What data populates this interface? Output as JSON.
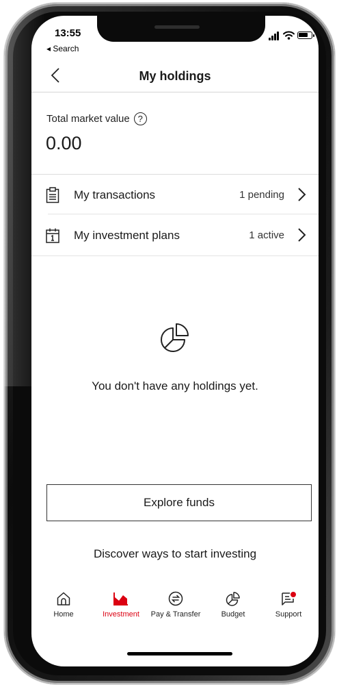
{
  "status_bar": {
    "time": "13:55",
    "back_label": "◂ Search"
  },
  "header": {
    "title": "My holdings",
    "back_icon": "chevron-left-icon"
  },
  "portfolio": {
    "total_label": "Total market value",
    "help_icon": "question-circle-icon",
    "help_glyph": "?",
    "total_value": "0.00"
  },
  "rows": [
    {
      "label": "My transactions",
      "status": "1 pending",
      "icon": "clipboard-list-icon"
    },
    {
      "label": "My investment plans",
      "status": "1 active",
      "icon": "calendar-icon"
    }
  ],
  "empty_state": {
    "icon": "pie-chart-icon",
    "message": "You don't have any holdings yet."
  },
  "actions": {
    "explore_label": "Explore funds",
    "discover_text": "Discover ways to start investing"
  },
  "bottom_nav": {
    "items": [
      {
        "label": "Home",
        "icon": "home-icon",
        "active": false
      },
      {
        "label": "Investment",
        "icon": "investment-chart-icon",
        "active": true
      },
      {
        "label": "Pay & Transfer",
        "icon": "transfer-arrows-icon",
        "active": false
      },
      {
        "label": "Budget",
        "icon": "pie-chart-icon",
        "active": false
      },
      {
        "label": "Support",
        "icon": "chat-support-icon",
        "active": false
      }
    ]
  },
  "colors": {
    "accent": "#db0011",
    "text": "#1a1a1a",
    "divider": "#dcdcdc",
    "background": "#ffffff"
  }
}
